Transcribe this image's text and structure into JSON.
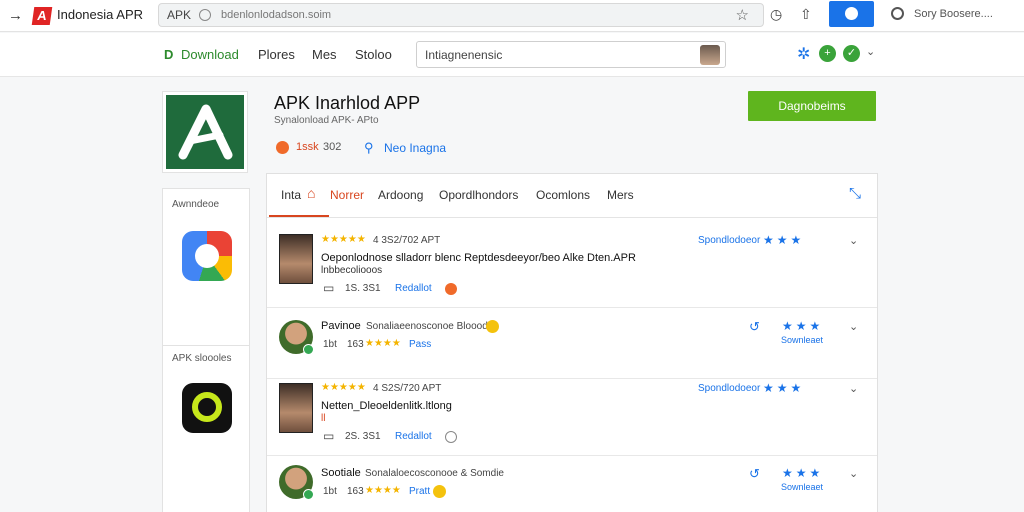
{
  "browser": {
    "tab_title": "Indonesia APR",
    "url_prefix": "APK",
    "url": "bdenlonlodadson.soim",
    "search_placeholder": "Sory Boosere....",
    "icons": [
      "back-arrow-icon",
      "star-icon",
      "history-icon",
      "share-icon",
      "profile-icon",
      "search-icon"
    ]
  },
  "nav": {
    "brand_letter": "D",
    "download": "Download",
    "links": [
      "Plores",
      "Mes",
      "Stoloo"
    ],
    "search_value": "Intiagnenensic",
    "icons": [
      "gear-icon",
      "plus-circle-icon",
      "check-circle-icon",
      "chevron-down-icon"
    ]
  },
  "app": {
    "title": "APK Inarhlod APP",
    "subtitle": "Synalonload APK- APto",
    "stat_count": "1ssk",
    "stat_extra": "302",
    "link": "Neo Inagna",
    "download_button": "Dagnobeims",
    "accent_color": "#5fb51e"
  },
  "sidebar": {
    "section1": "Awnndeoe",
    "section2": "APK sloooles"
  },
  "tabs": {
    "items": [
      "Inta",
      "Norrer",
      "Ardoong",
      "Opordlhondors",
      "Ocomlons",
      "Mers"
    ],
    "active_index": 1
  },
  "reviews": [
    {
      "stars": "★★★★★",
      "meta": "4 3S2/702 APT",
      "title": "Oeponlodnose slladorr blenc Reptdesdeeyor/beo Alke Dten.APR",
      "subtitle": "lnbbecoliooos",
      "count": "1S. 3S1",
      "action": "Redallot",
      "right_label": "Spondlodoeor",
      "right_stars": "★★★",
      "right_sub": ""
    },
    {
      "name": "Pavinoe",
      "text": "Sonaliaeenosconoe Bloood",
      "meta_a": "1bt",
      "meta_b": "163",
      "stars": "★★★★",
      "rating_label": "Pass",
      "right_stars": "★★★",
      "right_sub": "Sownleaet"
    },
    {
      "stars": "★★★★★",
      "meta": "4 S2S/720 APT",
      "title": "Netten_Dleoeldenlitk.ltlong",
      "subtitle": "ll",
      "count": "2S. 3S1",
      "action": "Redallot",
      "right_label": "Spondlodoeor",
      "right_stars": "★★★",
      "right_sub": ""
    },
    {
      "name": "Sootiale",
      "text": "Sonalaloecosconooe & Somdie",
      "meta_a": "1bt",
      "meta_b": "163",
      "stars": "★★★★",
      "rating_label": "Pratt",
      "right_stars": "★★★",
      "right_sub": "Sownleaet"
    }
  ]
}
